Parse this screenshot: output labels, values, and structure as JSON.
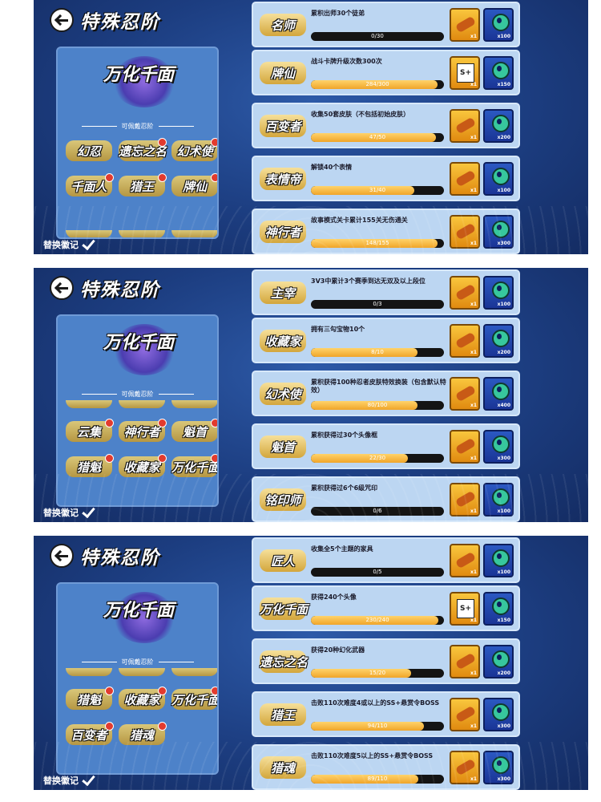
{
  "header": {
    "title": "特殊忍阶"
  },
  "left": {
    "featured_badge": "万化千面",
    "wearable_label": "可佩戴忍阶",
    "replace_label": "替换徽记"
  },
  "panels": [
    {
      "badges": [
        {
          "label": "幻忍",
          "dot": false
        },
        {
          "label": "遗忘之名",
          "dot": true
        },
        {
          "label": "幻术使",
          "dot": true
        },
        {
          "label": "千面人",
          "dot": true
        },
        {
          "label": "猎王",
          "dot": true
        },
        {
          "label": "牌仙",
          "dot": true
        }
      ],
      "rows": [
        {
          "badge": "名师",
          "desc": "累积出师30个徒弟",
          "progress": "0/30",
          "fraction": 0.0,
          "reward1": "scroll",
          "q1": "x1",
          "q2": "x100"
        },
        {
          "badge": "牌仙",
          "desc": "战斗卡牌升级次数300次",
          "progress": "284/300",
          "fraction": 0.95,
          "reward1": "card",
          "q1": "x1",
          "q2": "x150"
        },
        {
          "badge": "百变者",
          "desc": "收集50套皮肤（不包括初始皮肤）",
          "progress": "47/50",
          "fraction": 0.94,
          "reward1": "scroll",
          "q1": "x1",
          "q2": "x200"
        },
        {
          "badge": "表情帝",
          "desc": "解锁40个表情",
          "progress": "31/40",
          "fraction": 0.78,
          "reward1": "scroll",
          "q1": "x1",
          "q2": "x100"
        },
        {
          "badge": "神行者",
          "desc": "故事模式关卡累计155关无伤通关",
          "progress": "148/155",
          "fraction": 0.95,
          "reward1": "scroll",
          "q1": "x1",
          "q2": "x300"
        }
      ]
    },
    {
      "badges": [
        {
          "label": "云集",
          "dot": true
        },
        {
          "label": "神行者",
          "dot": true
        },
        {
          "label": "魁首",
          "dot": true
        },
        {
          "label": "猎魁",
          "dot": true
        },
        {
          "label": "收藏家",
          "dot": true
        },
        {
          "label": "万化千面",
          "dot": true
        }
      ],
      "rows": [
        {
          "badge": "主宰",
          "desc": "3V3中累计3个赛季到达无双及以上段位",
          "progress": "0/3",
          "fraction": 0.0,
          "reward1": "scroll",
          "q1": "x1",
          "q2": "x100"
        },
        {
          "badge": "收藏家",
          "desc": "拥有三勾宝物10个",
          "progress": "8/10",
          "fraction": 0.8,
          "reward1": "scroll",
          "q1": "x1",
          "q2": "x200"
        },
        {
          "badge": "幻术使",
          "desc": "累积获得100种忍者皮肤特效换装（包含默认特效）",
          "progress": "80/100",
          "fraction": 0.8,
          "reward1": "scroll",
          "q1": "x1",
          "q2": "x400"
        },
        {
          "badge": "魁首",
          "desc": "累积获得过30个头像框",
          "progress": "22/30",
          "fraction": 0.73,
          "reward1": "scroll",
          "q1": "x1",
          "q2": "x300"
        },
        {
          "badge": "铭印师",
          "desc": "累积获得过6个6级咒印",
          "progress": "0/6",
          "fraction": 0.0,
          "reward1": "scroll",
          "q1": "x1",
          "q2": "x100"
        }
      ]
    },
    {
      "badges": [
        {
          "label": "猎魁",
          "dot": true
        },
        {
          "label": "收藏家",
          "dot": true
        },
        {
          "label": "万化千面",
          "dot": true
        },
        {
          "label": "百变者",
          "dot": true
        },
        {
          "label": "猎魂",
          "dot": true
        }
      ],
      "rows": [
        {
          "badge": "匠人",
          "desc": "收集全5个主题的家具",
          "progress": "0/5",
          "fraction": 0.0,
          "reward1": "scroll",
          "q1": "x1",
          "q2": "x100"
        },
        {
          "badge": "万化千面",
          "desc": "获得240个头像",
          "progress": "230/240",
          "fraction": 0.96,
          "reward1": "card",
          "q1": "x1",
          "q2": "x150"
        },
        {
          "badge": "遗忘之名",
          "desc": "获得20种幻化武器",
          "progress": "15/20",
          "fraction": 0.75,
          "reward1": "scroll",
          "q1": "x1",
          "q2": "x200"
        },
        {
          "badge": "猎王",
          "desc": "击败110次难度4或以上的SS+悬赏令BOSS",
          "progress": "94/110",
          "fraction": 0.85,
          "reward1": "scroll",
          "q1": "x1",
          "q2": "x300"
        },
        {
          "badge": "猎魂",
          "desc": "击败110次难度5以上的SS+悬赏令BOSS",
          "progress": "89/110",
          "fraction": 0.81,
          "reward1": "scroll",
          "q1": "x1",
          "q2": "x300"
        }
      ]
    }
  ]
}
